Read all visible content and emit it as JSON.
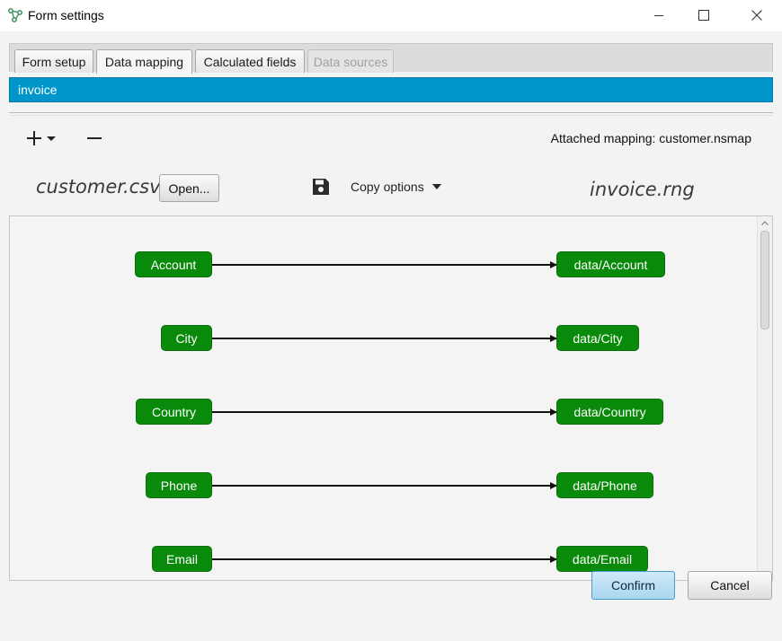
{
  "window": {
    "title": "Form settings",
    "icon": "app-network-icon",
    "controls": [
      "minimize-icon",
      "maximize-icon",
      "close-icon"
    ]
  },
  "tabs": [
    {
      "label": "Form setup",
      "state": "normal"
    },
    {
      "label": "Data mapping",
      "state": "active"
    },
    {
      "label": "Calculated fields",
      "state": "normal"
    },
    {
      "label": "Data sources",
      "state": "disabled"
    }
  ],
  "mapping_list": {
    "selected": "invoice"
  },
  "toolbar": {
    "add_icon": "plus-dropdown-icon",
    "remove_icon": "minus-icon",
    "attached_mapping": "Attached mapping: customer.nsmap"
  },
  "mapping_header": {
    "source_file": "customer.csv",
    "open_label": "Open...",
    "save_icon": "save-icon",
    "copy_options_label": "Copy options",
    "target_file": "invoice.rng"
  },
  "mappings": [
    {
      "source": "Account",
      "target": "data/Account"
    },
    {
      "source": "City",
      "target": "data/City"
    },
    {
      "source": "Country",
      "target": "data/Country"
    },
    {
      "source": "Phone",
      "target": "data/Phone"
    },
    {
      "source": "Email",
      "target": "data/Email"
    }
  ],
  "colors": {
    "selection": "#0096c9",
    "node_fill": "#0a8a0a",
    "connector": "#111111"
  },
  "footer": {
    "confirm_label": "Confirm",
    "cancel_label": "Cancel"
  }
}
